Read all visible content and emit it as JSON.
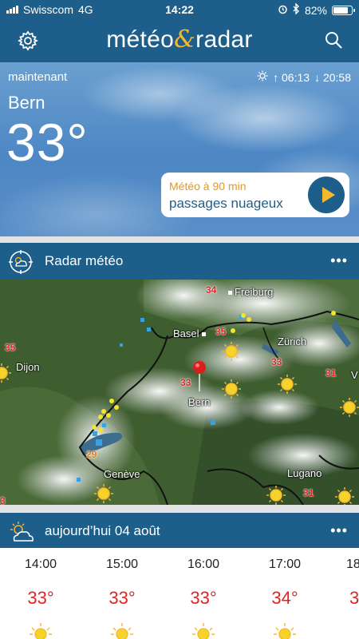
{
  "status": {
    "carrier": "Swisscom",
    "network": "4G",
    "time": "14:22",
    "battery": "82%",
    "battery_level": 0.82
  },
  "header": {
    "logo_left": "météo",
    "logo_amp": "&",
    "logo_right": "radar"
  },
  "hero": {
    "label": "maintenant",
    "city": "Bern",
    "temperature": "33°",
    "sunrise": "↑ 06:13",
    "sunset": "↓ 20:58",
    "forecast_title": "Météo à 90 min",
    "forecast_text": "passages nuageux"
  },
  "radar": {
    "title": "Radar météo",
    "more": "•••",
    "cities": [
      "Freiburg",
      "Basel",
      "Zürich",
      "Dijon",
      "Bern",
      "Genève",
      "Lugano",
      "V"
    ],
    "temps": [
      "34",
      "35",
      "35",
      "33",
      "33",
      "31",
      "29",
      "31",
      "3"
    ]
  },
  "today": {
    "title": "aujourd’hui 04 août",
    "more": "•••"
  },
  "hourly": [
    {
      "time": "14:00",
      "temp": "33°"
    },
    {
      "time": "15:00",
      "temp": "33°"
    },
    {
      "time": "16:00",
      "temp": "33°"
    },
    {
      "time": "17:00",
      "temp": "34°"
    },
    {
      "time": "18",
      "temp": "3"
    }
  ]
}
